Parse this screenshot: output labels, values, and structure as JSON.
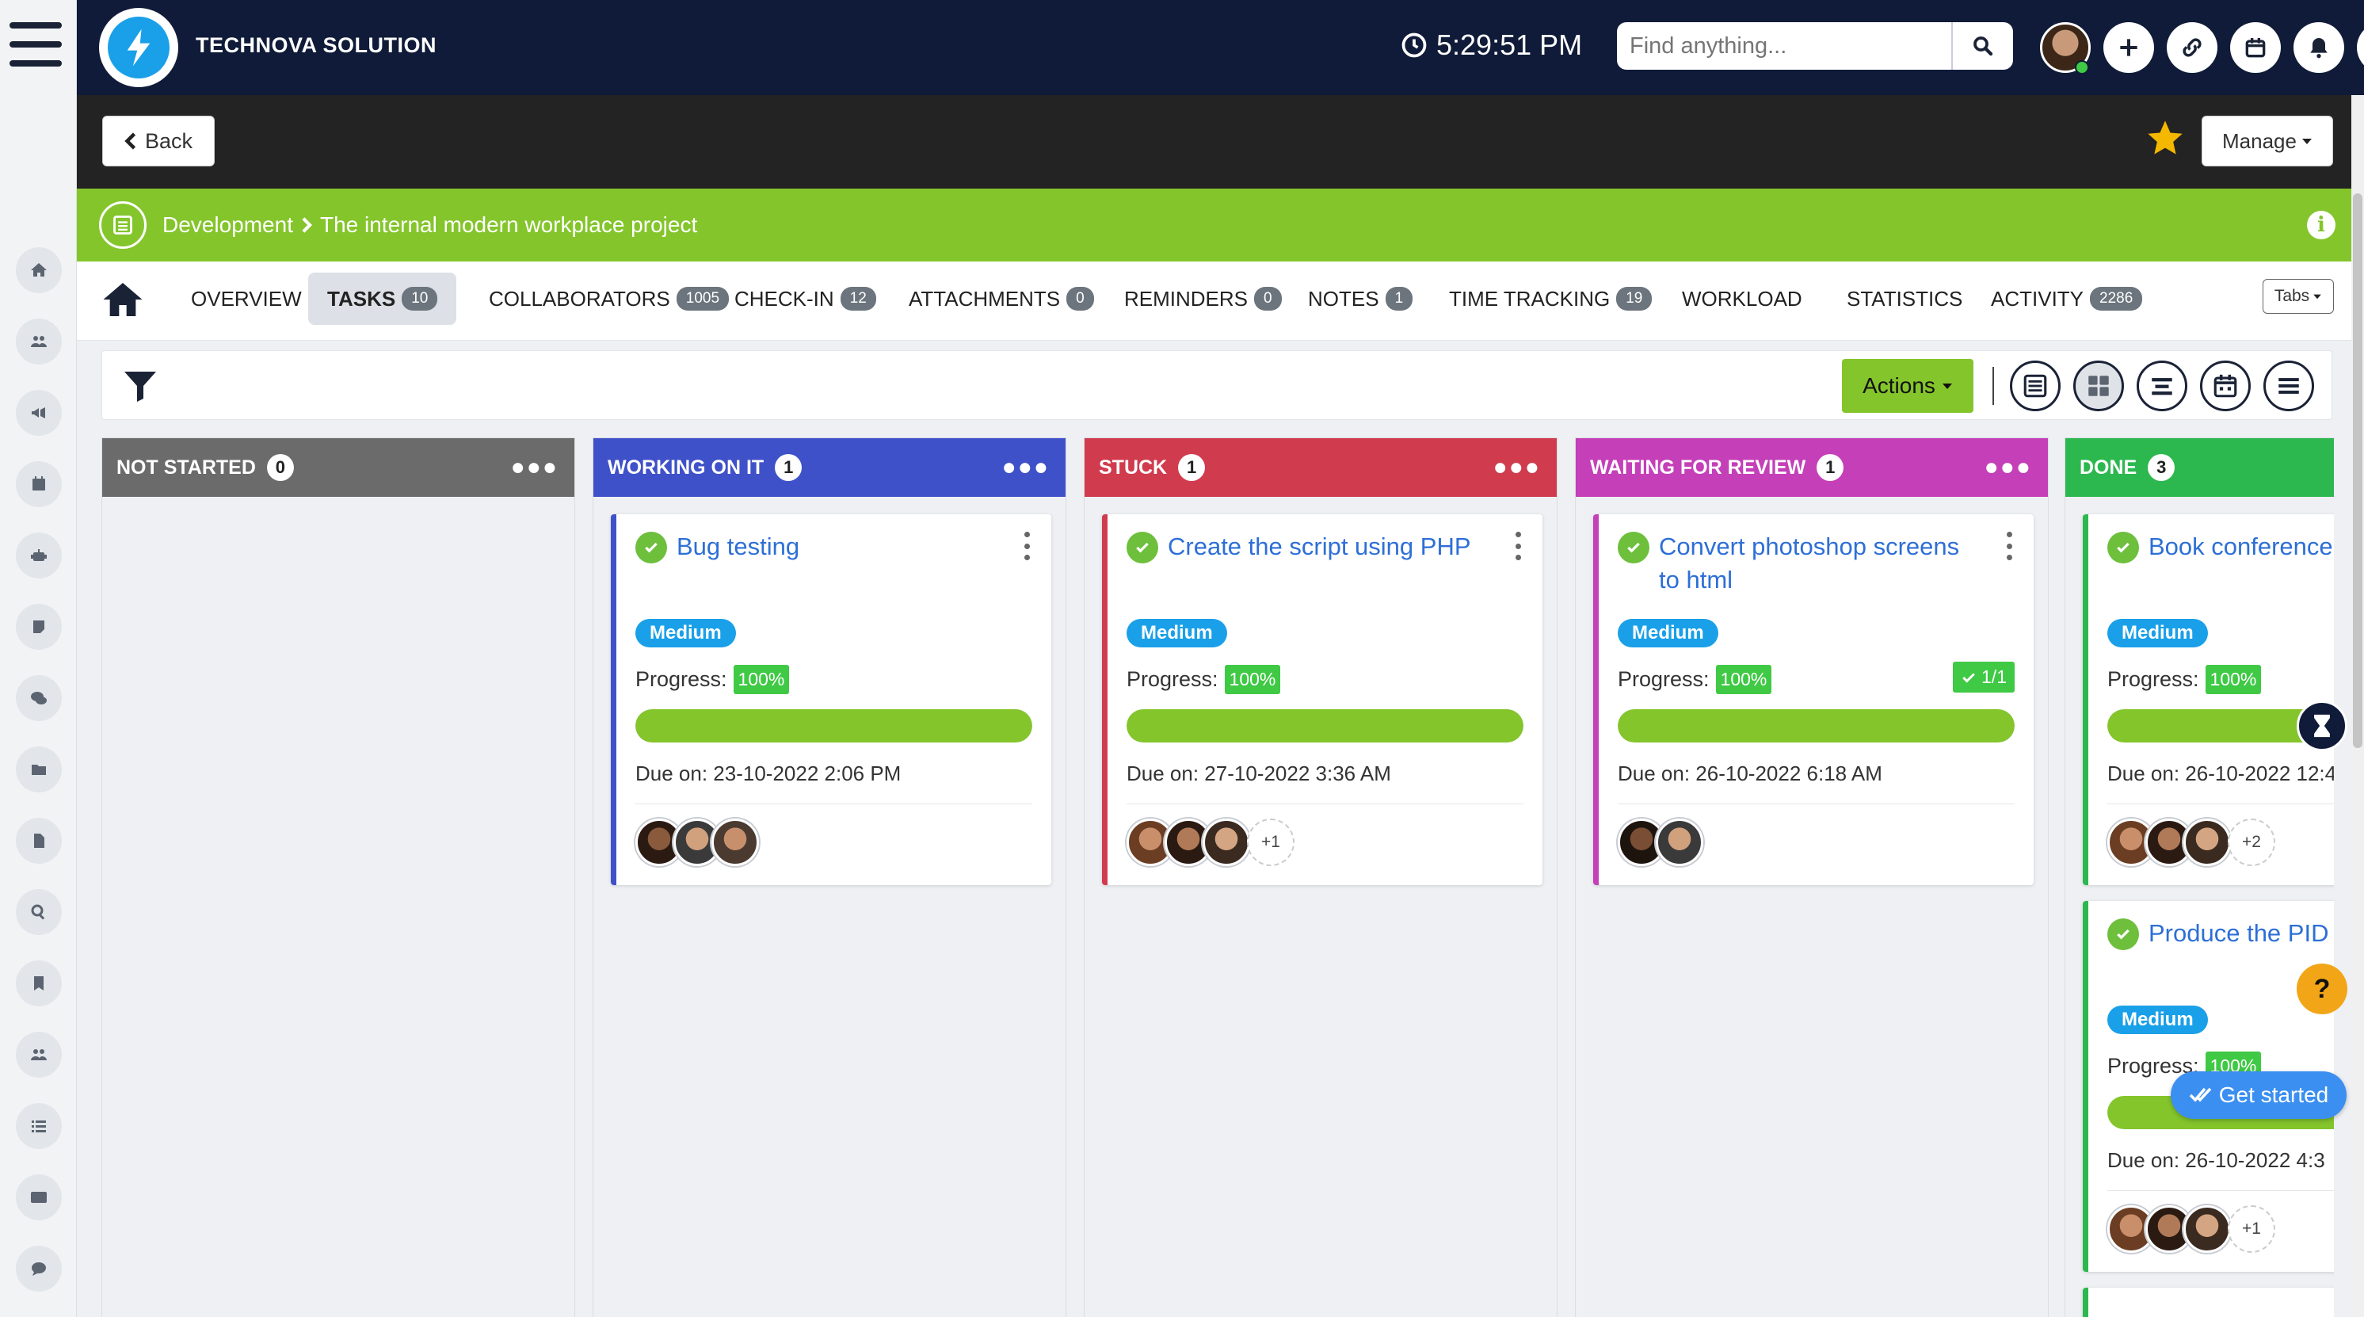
{
  "header": {
    "brand": "TECHNOVA SOLUTION",
    "clock": "5:29:51 PM",
    "search_placeholder": "Find anything..."
  },
  "toolbar": {
    "back_label": "Back",
    "manage_label": "Manage"
  },
  "breadcrumb": {
    "parent": "Development",
    "current": "The internal modern workplace project"
  },
  "tabs": [
    {
      "label": "OVERVIEW",
      "badge": ""
    },
    {
      "label": "TASKS",
      "badge": "10"
    },
    {
      "label": "COLLABORATORS",
      "badge": "1005"
    },
    {
      "label": "CHECK-IN",
      "badge": "12"
    },
    {
      "label": "ATTACHMENTS",
      "badge": "0"
    },
    {
      "label": "REMINDERS",
      "badge": "0"
    },
    {
      "label": "NOTES",
      "badge": "1"
    },
    {
      "label": "TIME TRACKING",
      "badge": "19"
    },
    {
      "label": "WORKLOAD",
      "badge": ""
    },
    {
      "label": "STATISTICS",
      "badge": ""
    },
    {
      "label": "ACTIVITY",
      "badge": "2286"
    }
  ],
  "tabs_select_label": "Tabs",
  "actions_label": "Actions",
  "columns": [
    {
      "title": "NOT STARTED",
      "count": "0",
      "color": "#6b6b6b"
    },
    {
      "title": "WORKING ON IT",
      "count": "1",
      "color": "#3f51c9"
    },
    {
      "title": "STUCK",
      "count": "1",
      "color": "#d13b4e"
    },
    {
      "title": "WAITING FOR REVIEW",
      "count": "1",
      "color": "#c43fb8"
    },
    {
      "title": "DONE",
      "count": "3",
      "color": "#2cb84f"
    }
  ],
  "progress_label": "Progress:",
  "cards": {
    "bug": {
      "title": "Bug testing",
      "priority": "Medium",
      "progress": "100%",
      "progress_value": 100,
      "due": "Due on: 23-10-2022 2:06 PM",
      "more": ""
    },
    "php": {
      "title": "Create the script using PHP",
      "priority": "Medium",
      "progress": "100%",
      "progress_value": 100,
      "due": "Due on: 27-10-2022 3:36 AM",
      "more": "+1"
    },
    "psd": {
      "title": "Convert photoshop screens to html",
      "priority": "Medium",
      "progress": "100%",
      "progress_value": 100,
      "subtasks": "1/1",
      "due": "Due on: 26-10-2022 6:18 AM",
      "more": ""
    },
    "book": {
      "title": "Book conference",
      "priority": "Medium",
      "progress": "100%",
      "progress_value": 100,
      "due": "Due on: 26-10-2022 12:4",
      "more": "+2"
    },
    "pid": {
      "title": "Produce the PID",
      "priority": "Medium",
      "progress": "100%",
      "progress_value": 100,
      "due": "Due on: 26-10-2022 4:3",
      "more": "+1"
    }
  },
  "get_started": "Get started",
  "help_label": "?",
  "colors": {
    "navy": "#0f1b38",
    "green": "#84c52c",
    "blue": "#1aa0e8",
    "link": "#2d6fd6"
  }
}
